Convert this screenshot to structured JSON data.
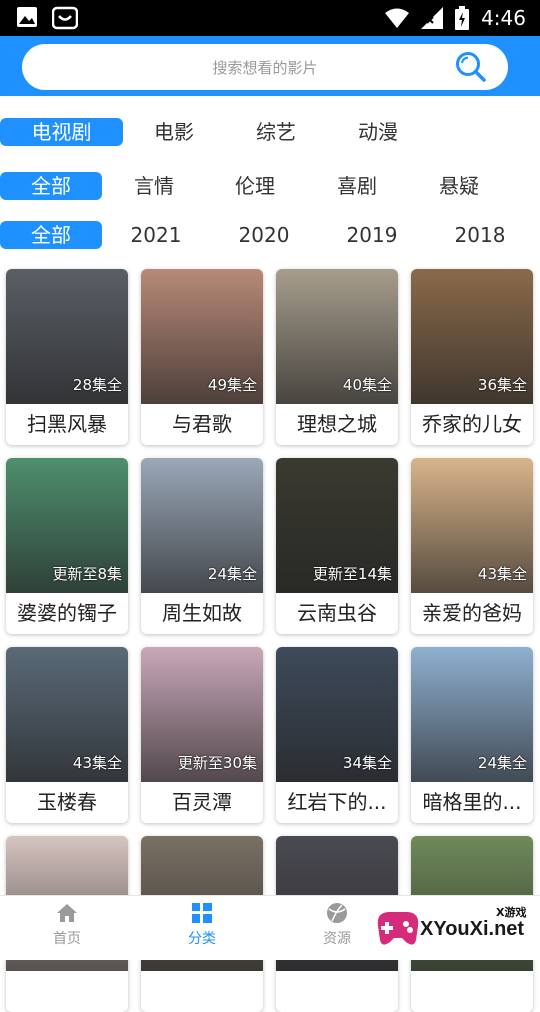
{
  "status_bar": {
    "time": "4:46",
    "icons": [
      "image-icon",
      "app-icon",
      "wifi-icon",
      "signal-icon",
      "battery-icon"
    ]
  },
  "search": {
    "placeholder": "搜索想看的影片",
    "icon": "search-icon"
  },
  "filters": {
    "categories": [
      {
        "label": "电视剧",
        "active": true
      },
      {
        "label": "电影",
        "active": false
      },
      {
        "label": "综艺",
        "active": false
      },
      {
        "label": "动漫",
        "active": false
      }
    ],
    "genres": [
      {
        "label": "全部",
        "active": true
      },
      {
        "label": "言情",
        "active": false
      },
      {
        "label": "伦理",
        "active": false
      },
      {
        "label": "喜剧",
        "active": false
      },
      {
        "label": "悬疑",
        "active": false
      }
    ],
    "years": [
      {
        "label": "全部",
        "active": true
      },
      {
        "label": "2021",
        "active": false
      },
      {
        "label": "2020",
        "active": false
      },
      {
        "label": "2019",
        "active": false
      },
      {
        "label": "2018",
        "active": false
      }
    ]
  },
  "shows": [
    {
      "title": "扫黑风暴",
      "badge": "28集全",
      "color": "#5a5f66"
    },
    {
      "title": "与君歌",
      "badge": "49集全",
      "color": "#b88a78"
    },
    {
      "title": "理想之城",
      "badge": "40集全",
      "color": "#a79d8c"
    },
    {
      "title": "乔家的儿女",
      "badge": "36集全",
      "color": "#8a6a4a"
    },
    {
      "title": "婆婆的镯子",
      "badge": "更新至8集",
      "color": "#4f8f6f"
    },
    {
      "title": "周生如故",
      "badge": "24集全",
      "color": "#9aa8b8"
    },
    {
      "title": "云南虫谷",
      "badge": "更新至14集",
      "color": "#3a3a30"
    },
    {
      "title": "亲爱的爸妈",
      "badge": "43集全",
      "color": "#d9b48a"
    },
    {
      "title": "玉楼春",
      "badge": "43集全",
      "color": "#5a6a78"
    },
    {
      "title": "百灵潭",
      "badge": "更新至30集",
      "color": "#c9a8b8"
    },
    {
      "title": "红岩下的...",
      "badge": "34集全",
      "color": "#3e4a5a"
    },
    {
      "title": "暗格里的...",
      "badge": "24集全",
      "color": "#8fb0d0"
    },
    {
      "title": "",
      "badge": "",
      "color": "#d6c4c0"
    },
    {
      "title": "",
      "badge": "",
      "color": "#7a7064"
    },
    {
      "title": "",
      "badge": "",
      "color": "#4a4a52"
    },
    {
      "title": "",
      "badge": "",
      "color": "#6f8a5a"
    }
  ],
  "tabbar": [
    {
      "label": "首页",
      "icon": "home-icon",
      "active": false
    },
    {
      "label": "分类",
      "icon": "grid-icon",
      "active": true
    },
    {
      "label": "资源",
      "icon": "ball-icon",
      "active": false
    }
  ],
  "watermark": {
    "text": "XYouXi.net",
    "small": "X游戏"
  },
  "colors": {
    "accent": "#1E90FF",
    "statusbar": "#000000"
  }
}
